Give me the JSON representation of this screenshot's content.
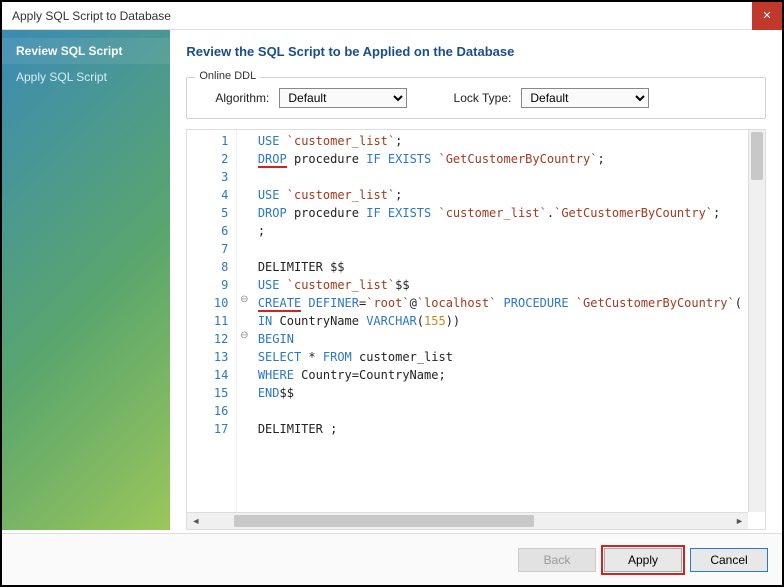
{
  "window": {
    "title": "Apply SQL Script to Database"
  },
  "sidebar": {
    "items": [
      {
        "label": "Review SQL Script",
        "active": true
      },
      {
        "label": "Apply SQL Script",
        "active": false
      }
    ]
  },
  "main": {
    "heading": "Review the SQL Script to be Applied on the Database",
    "ddl": {
      "legend": "Online DDL",
      "algo_label": "Algorithm:",
      "algo_value": "Default",
      "lock_label": "Lock Type:",
      "lock_value": "Default"
    },
    "code": {
      "lines": [
        {
          "n": 1,
          "tokens": [
            [
              "kw",
              "USE"
            ],
            [
              "txt",
              " "
            ],
            [
              "str",
              "`customer_list`"
            ],
            [
              "txt",
              ";"
            ]
          ]
        },
        {
          "n": 2,
          "tokens": [
            [
              "kw",
              "DROP"
            ],
            [
              "txt",
              " procedure "
            ],
            [
              "kw",
              "IF EXISTS"
            ],
            [
              "txt",
              " "
            ],
            [
              "str",
              "`GetCustomerByCountry`"
            ],
            [
              "txt",
              ";"
            ]
          ],
          "underline_first": true
        },
        {
          "n": 3,
          "tokens": []
        },
        {
          "n": 4,
          "tokens": [
            [
              "kw",
              "USE"
            ],
            [
              "txt",
              " "
            ],
            [
              "str",
              "`customer_list`"
            ],
            [
              "txt",
              ";"
            ]
          ]
        },
        {
          "n": 5,
          "tokens": [
            [
              "kw",
              "DROP"
            ],
            [
              "txt",
              " procedure "
            ],
            [
              "kw",
              "IF EXISTS"
            ],
            [
              "txt",
              " "
            ],
            [
              "str",
              "`customer_list`"
            ],
            [
              "txt",
              "."
            ],
            [
              "str",
              "`GetCustomerByCountry`"
            ],
            [
              "txt",
              ";"
            ]
          ]
        },
        {
          "n": 6,
          "tokens": [
            [
              "txt",
              ";"
            ]
          ]
        },
        {
          "n": 7,
          "tokens": []
        },
        {
          "n": 8,
          "tokens": [
            [
              "txt",
              "DELIMITER $$"
            ]
          ]
        },
        {
          "n": 9,
          "tokens": [
            [
              "kw",
              "USE"
            ],
            [
              "txt",
              " "
            ],
            [
              "str",
              "`customer_list`"
            ],
            [
              "txt",
              "$$"
            ]
          ]
        },
        {
          "n": 10,
          "tokens": [
            [
              "kw",
              "CREATE"
            ],
            [
              "txt",
              " "
            ],
            [
              "kw",
              "DEFINER"
            ],
            [
              "txt",
              "="
            ],
            [
              "str",
              "`root`"
            ],
            [
              "txt",
              "@"
            ],
            [
              "str",
              "`localhost`"
            ],
            [
              "txt",
              " "
            ],
            [
              "kw",
              "PROCEDURE"
            ],
            [
              "txt",
              " "
            ],
            [
              "str",
              "`GetCustomerByCountry`"
            ],
            [
              "txt",
              "("
            ]
          ],
          "underline_first": true,
          "fold": "⊖"
        },
        {
          "n": 11,
          "tokens": [
            [
              "kw",
              "IN"
            ],
            [
              "txt",
              " CountryName "
            ],
            [
              "kw",
              "VARCHAR"
            ],
            [
              "txt",
              "("
            ],
            [
              "num",
              "155"
            ],
            [
              "txt",
              "))"
            ]
          ]
        },
        {
          "n": 12,
          "tokens": [
            [
              "kw",
              "BEGIN"
            ]
          ],
          "fold": "⊖"
        },
        {
          "n": 13,
          "tokens": [
            [
              "kw",
              "SELECT"
            ],
            [
              "txt",
              " * "
            ],
            [
              "kw",
              "FROM"
            ],
            [
              "txt",
              " customer_list"
            ]
          ]
        },
        {
          "n": 14,
          "tokens": [
            [
              "kw",
              "WHERE"
            ],
            [
              "txt",
              " Country=CountryName;"
            ]
          ]
        },
        {
          "n": 15,
          "tokens": [
            [
              "kw",
              "END"
            ],
            [
              "txt",
              "$$"
            ]
          ]
        },
        {
          "n": 16,
          "tokens": []
        },
        {
          "n": 17,
          "tokens": [
            [
              "txt",
              "DELIMITER ;"
            ]
          ]
        }
      ]
    }
  },
  "footer": {
    "back": "Back",
    "apply": "Apply",
    "cancel": "Cancel"
  }
}
